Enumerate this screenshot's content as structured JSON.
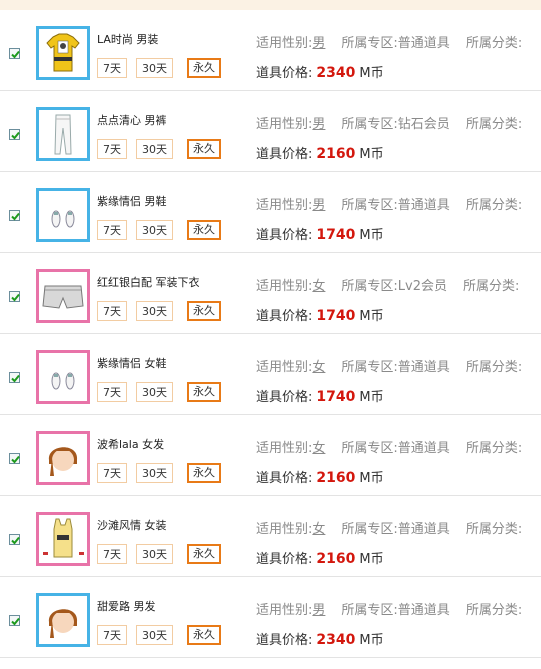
{
  "labels": {
    "gender": "适用性别:",
    "zone": "所属专区:",
    "category": "所属分类:",
    "price": "道具价格:",
    "currency": "M币"
  },
  "items": [
    {
      "name": "LA时尚  男装",
      "gender": "男",
      "zone": "普通道具",
      "price": "2340",
      "buttons": [
        "7天",
        "30天",
        "永久"
      ],
      "frame": "male",
      "icon": "tshirt-icon",
      "checked": true
    },
    {
      "name": "点点清心  男裤",
      "gender": "男",
      "zone": "钻石会员",
      "price": "2160",
      "buttons": [
        "7天",
        "30天",
        "永久"
      ],
      "frame": "male",
      "icon": "pants-icon",
      "checked": true
    },
    {
      "name": "紫缘情侣  男鞋",
      "gender": "男",
      "zone": "普通道具",
      "price": "1740",
      "buttons": [
        "7天",
        "30天",
        "永久"
      ],
      "frame": "male",
      "icon": "shoes-icon",
      "checked": true
    },
    {
      "name": "红红银白配  军装下衣",
      "gender": "女",
      "zone": "Lv2会员",
      "price": "1740",
      "buttons": [
        "7天",
        "30天",
        "永久"
      ],
      "frame": "female",
      "icon": "shorts-icon",
      "checked": true
    },
    {
      "name": "紫缘情侣  女鞋",
      "gender": "女",
      "zone": "普通道具",
      "price": "1740",
      "buttons": [
        "7天",
        "30天",
        "永久"
      ],
      "frame": "female",
      "icon": "shoes-icon",
      "checked": true
    },
    {
      "name": "波希lala 女发",
      "gender": "女",
      "zone": "普通道具",
      "price": "2160",
      "buttons": [
        "7天",
        "30天",
        "永久"
      ],
      "frame": "female",
      "icon": "hair-icon",
      "checked": true
    },
    {
      "name": "沙滩风情  女装",
      "gender": "女",
      "zone": "普通道具",
      "price": "2160",
      "buttons": [
        "7天",
        "30天",
        "永久"
      ],
      "frame": "female",
      "icon": "tanktop-icon",
      "checked": true
    },
    {
      "name": "甜爱路  男发",
      "gender": "男",
      "zone": "普通道具",
      "price": "2340",
      "buttons": [
        "7天",
        "30天",
        "永久"
      ],
      "frame": "male",
      "icon": "hair-icon",
      "checked": true
    }
  ]
}
